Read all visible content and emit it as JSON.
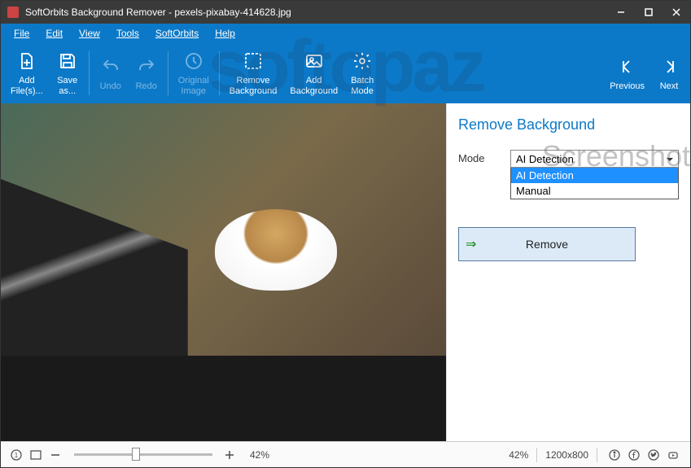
{
  "window": {
    "title": "SoftOrbits Background Remover - pexels-pixabay-414628.jpg"
  },
  "menu": {
    "file": "File",
    "edit": "Edit",
    "view": "View",
    "tools": "Tools",
    "softorbits": "SoftOrbits",
    "help": "Help"
  },
  "toolbar": {
    "add_files": "Add\nFile(s)...",
    "save_as": "Save\nas...",
    "undo": "Undo",
    "redo": "Redo",
    "original_image": "Original\nImage",
    "remove_bg": "Remove\nBackground",
    "add_bg": "Add\nBackground",
    "batch": "Batch\nMode",
    "previous": "Previous",
    "next": "Next"
  },
  "panel": {
    "title": "Remove Background",
    "mode_label": "Mode",
    "mode_selected": "AI Detection",
    "mode_options": {
      "ai": "AI Detection",
      "manual": "Manual"
    },
    "remove_btn": "Remove"
  },
  "status": {
    "zoom_left": "42%",
    "zoom_right": "42%",
    "dimensions": "1200x800"
  },
  "watermark": {
    "brand": "softopaz",
    "screenshot": "Screenshot"
  }
}
